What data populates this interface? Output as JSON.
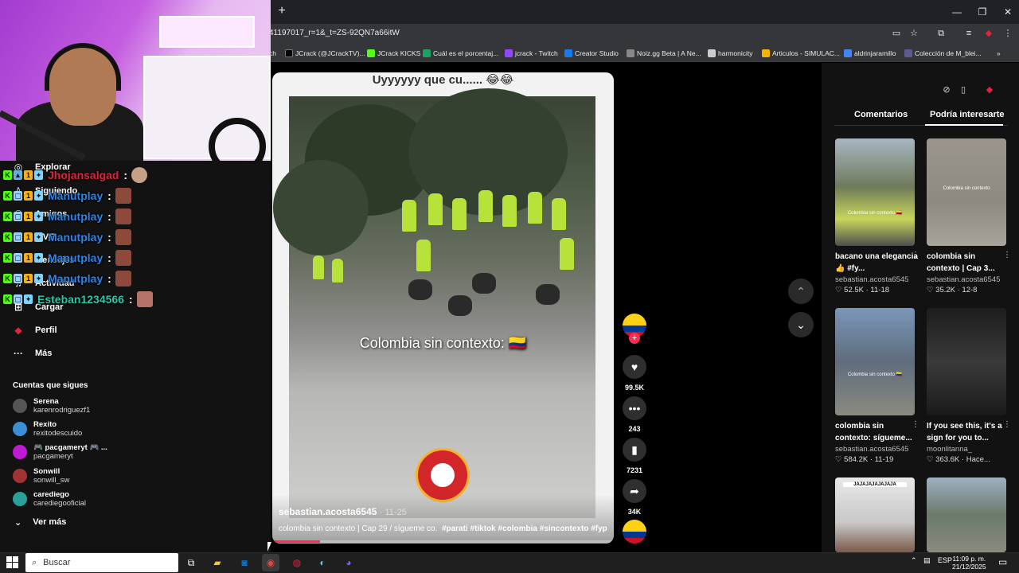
{
  "browser": {
    "url": "41197017_r=1&_t=ZS-92QN7a66itW",
    "new_tab": "+",
    "window_controls": {
      "minimize": "—",
      "restore": "❐",
      "close": "✕"
    },
    "bookmarks": [
      {
        "label": "ch",
        "color": "#35363a"
      },
      {
        "label": "JCrack (@JCrackTV)...",
        "color": "#000000"
      },
      {
        "label": "JCrack KICKS",
        "color": "#53fc18"
      },
      {
        "label": "Cuál es el porcentaj...",
        "color": "#1aa260"
      },
      {
        "label": "jcrack - Twitch",
        "color": "#9146ff"
      },
      {
        "label": "Creator Studio",
        "color": "#1877f2"
      },
      {
        "label": "Noiz.gg Beta | A Ne...",
        "color": "#888888"
      },
      {
        "label": "harmonicity",
        "color": "#cccccc"
      },
      {
        "label": "Articulos - SIMULAC...",
        "color": "#f4b400"
      },
      {
        "label": "aldrinjaramillo",
        "color": "#4285f4"
      },
      {
        "label": "Colección de M_blei...",
        "color": "#5b5b8f"
      }
    ],
    "bookmarks_overflow": "»"
  },
  "sidebar": {
    "nav": [
      {
        "label": "Explorar",
        "icon": "compass-icon"
      },
      {
        "label": "Siguiendo",
        "icon": "person-icon"
      },
      {
        "label": "Amigos",
        "icon": "friends-icon"
      },
      {
        "label": "LIVE",
        "icon": "live-icon"
      },
      {
        "label": "Mensajes",
        "icon": "message-icon"
      },
      {
        "label": "Actividad",
        "icon": "bell-icon"
      },
      {
        "label": "Cargar",
        "icon": "upload-icon"
      },
      {
        "label": "Perfil",
        "icon": "profile-icon"
      },
      {
        "label": "Más",
        "icon": "more-icon"
      }
    ],
    "following_title": "Cuentas que sigues",
    "following": [
      {
        "name": "Serena",
        "user": "karenrodriguezf1",
        "color": "#555555"
      },
      {
        "name": "Rexito",
        "user": "rexitodescuido",
        "color": "#3b8fd6"
      },
      {
        "name": "🎮 pacgameryt 🎮 ...",
        "user": "pacgameryt",
        "color": "#c01ad6"
      },
      {
        "name": "Sonwill",
        "user": "sonwill_sw",
        "color": "#a13333"
      },
      {
        "name": "carediego",
        "user": "carediegooficial",
        "color": "#2aa198"
      }
    ],
    "see_more": "Ver más"
  },
  "chat": [
    {
      "user": "Jhojansalgad",
      "color": "#e0243d"
    },
    {
      "user": "Manutplay",
      "color": "#2e84e6"
    },
    {
      "user": "Manutplay",
      "color": "#2e84e6"
    },
    {
      "user": "Manutplay",
      "color": "#2e84e6"
    },
    {
      "user": "Manutplay",
      "color": "#2e84e6"
    },
    {
      "user": "Manutplay",
      "color": "#2e84e6"
    },
    {
      "user": "Esteban1234566",
      "color": "#27c8a8"
    }
  ],
  "video": {
    "top_text": "Uyyyyyy que cu...... 😂😂",
    "overlay_text": "Colombia sin contexto: 🇨🇴",
    "author": "sebastian.acosta6545",
    "date": "· 11-25",
    "caption_plain": "colombia sin contexto | Cap 29 / sígueme co.",
    "caption_tags": "#parati #tiktok #colombia #sincontexto #fyp ...",
    "progress": 0.14
  },
  "actions": {
    "likes": "99.5K",
    "comments": "243",
    "saves": "7231",
    "shares": "34K"
  },
  "right_panel": {
    "tabs": [
      "Comentarios",
      "Podría interesarte"
    ],
    "cards": [
      {
        "title": "bacano una elegancia 👍 #fy...",
        "user": "sebastian.acosta6545",
        "meta": "♡ 52.5K · 11-18",
        "thumb_label": "Colombia sin contexto 🇨🇴",
        "bg": "#6f7a5a"
      },
      {
        "title": "colombia sin contexto | Cap 3...",
        "user": "sebastian.acosta6545",
        "meta": "♡ 35.2K · 12-8",
        "thumb_label": "Colombia sin contexto",
        "bg": "#8e8a82"
      },
      {
        "title": "colombia sin contexto: sígueme...",
        "user": "sebastian.acosta6545",
        "meta": "♡ 584.2K · 11-19",
        "thumb_label": "Colombia sin contexto 🇨🇴",
        "bg": "#5f6d7c"
      },
      {
        "title": "If you see this, it's a sign for you to...",
        "user": "moonlitanna_",
        "meta": "♡ 363.6K · Hace...",
        "thumb_label": "",
        "bg": "#2a2a2a"
      },
      {
        "title": "",
        "user": "",
        "meta": "",
        "thumb_label": "JAJAJAJAJAJAJA",
        "bg": "#d9d9d9"
      },
      {
        "title": "",
        "user": "",
        "meta": "",
        "thumb_label": "",
        "bg": "#6a7a6a"
      }
    ]
  },
  "taskbar": {
    "search_placeholder": "Buscar",
    "lang": "ESP",
    "time": "11:09 p. m.",
    "date": "21/12/2025"
  }
}
